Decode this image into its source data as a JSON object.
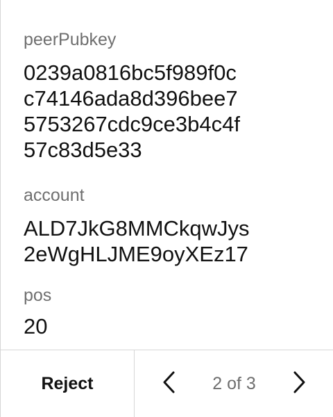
{
  "fields": {
    "peer_pubkey": {
      "label": "peerPubkey",
      "value": "0239a0816bc5f989f0c\nc74146ada8d396bee7\n5753267cdc9ce3b4c4f\n57c83d5e33"
    },
    "account": {
      "label": "account",
      "value": "ALD7JkG8MMCkqwJys\n2eWgHLJME9oyXEz17"
    },
    "pos": {
      "label": "pos",
      "value": "20"
    }
  },
  "footer": {
    "reject_label": "Reject",
    "page_indicator": "2 of 3",
    "prev_icon": "chevron-left-icon",
    "next_icon": "chevron-right-icon"
  },
  "colors": {
    "text": "#111111",
    "label": "#6f6f6f",
    "divider": "#d6d6d6"
  }
}
